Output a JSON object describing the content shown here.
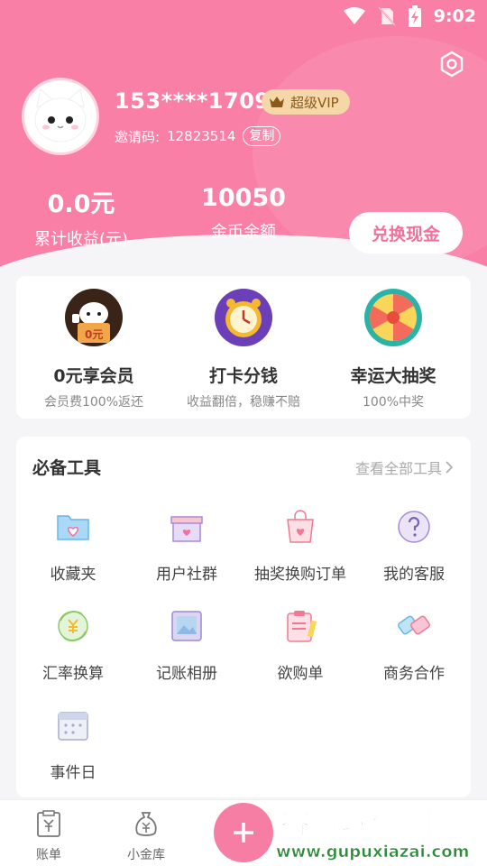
{
  "status": {
    "time": "9:02"
  },
  "profile": {
    "phone": "153****1709",
    "vip_label": "超级VIP",
    "invite_prefix": "邀请码:",
    "invite_code": "12823514",
    "copy_label": "复制"
  },
  "stats": {
    "earnings_value": "0.0元",
    "earnings_label": "累计收益(元)",
    "coins_value": "10050",
    "coins_label": "金币余额",
    "redeem_label": "兑换现金"
  },
  "promos": [
    {
      "title": "0元享会员",
      "subtitle": "会员费100%返还",
      "badge": "0元",
      "icon": "cat-membership-icon"
    },
    {
      "title": "打卡分钱",
      "subtitle": "收益翻倍，稳赚不赔",
      "icon": "alarm-clock-icon"
    },
    {
      "title": "幸运大抽奖",
      "subtitle": "100%中奖",
      "icon": "prize-wheel-icon"
    }
  ],
  "tools": {
    "title": "必备工具",
    "more_label": "查看全部工具",
    "items": [
      {
        "label": "收藏夹",
        "icon": "folder-heart-icon"
      },
      {
        "label": "用户社群",
        "icon": "gift-box-icon"
      },
      {
        "label": "抽奖换购订单",
        "icon": "shopping-bag-icon"
      },
      {
        "label": "我的客服",
        "icon": "help-icon"
      },
      {
        "label": "汇率换算",
        "icon": "currency-exchange-icon"
      },
      {
        "label": "记账相册",
        "icon": "photo-album-icon"
      },
      {
        "label": "欲购单",
        "icon": "clipboard-icon"
      },
      {
        "label": "商务合作",
        "icon": "handshake-icon"
      },
      {
        "label": "事件日",
        "icon": "calendar-icon"
      }
    ]
  },
  "tabbar": {
    "items": [
      {
        "label": "账单",
        "icon": "bill-icon"
      },
      {
        "label": "小金库",
        "icon": "money-bag-icon"
      }
    ],
    "add_label": "+"
  },
  "watermark": {
    "cn": "谷普软件园",
    "url": "www.gupuxiazai.com"
  },
  "colors": {
    "primary_pink": "#f97fa7",
    "vip_gold": "#f5d7a8",
    "accent_text": "#f27099"
  }
}
